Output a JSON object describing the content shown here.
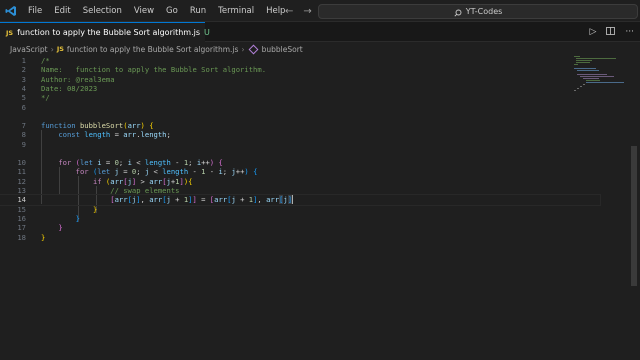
{
  "menu": [
    "File",
    "Edit",
    "Selection",
    "View",
    "Go",
    "Run",
    "Terminal",
    "Help"
  ],
  "command_center": {
    "label": "YT-Codes",
    "icon": "search-icon"
  },
  "tab": {
    "title": "function to apply the Bubble Sort algorithm.js",
    "status": "U",
    "language": "JS",
    "modified": true
  },
  "breadcrumb": [
    "JavaScript",
    "function to apply the Bubble Sort algorithm.js",
    "bubbleSort"
  ],
  "editor": {
    "active_line": 14,
    "lines": [
      {
        "n": "1"
      },
      {
        "n": "2"
      },
      {
        "n": "3"
      },
      {
        "n": "4"
      },
      {
        "n": "5"
      },
      {
        "n": "6"
      },
      {
        "n": "7"
      },
      {
        "n": "8"
      },
      {
        "n": "9"
      },
      {
        "n": "10"
      },
      {
        "n": "11"
      },
      {
        "n": "12"
      },
      {
        "n": "13"
      },
      {
        "n": "14"
      },
      {
        "n": "15"
      },
      {
        "n": "16"
      },
      {
        "n": "17"
      },
      {
        "n": "18"
      }
    ],
    "code": {
      "l1": "/*",
      "l2_a": "Name:",
      "l2_b": "function to apply the Bubble Sort algorithm.",
      "l3": "Author: @real3ema",
      "l4": "Date: 08/2023",
      "l5": "*/",
      "kw_function": "function",
      "fn_name": "bubbleSort",
      "param": "arr",
      "kw_const": "const",
      "const_name": "length",
      "prop_length": "length",
      "kw_for": "for",
      "kw_let": "let",
      "var_i": "i",
      "var_j": "j",
      "num_0": "0",
      "num_1": "1",
      "kw_if": "if",
      "comment_swap": "// swap elements"
    }
  },
  "colors": {
    "accent": "#0078d4",
    "js_icon": "#e8c33a",
    "untracked": "#73c991"
  }
}
